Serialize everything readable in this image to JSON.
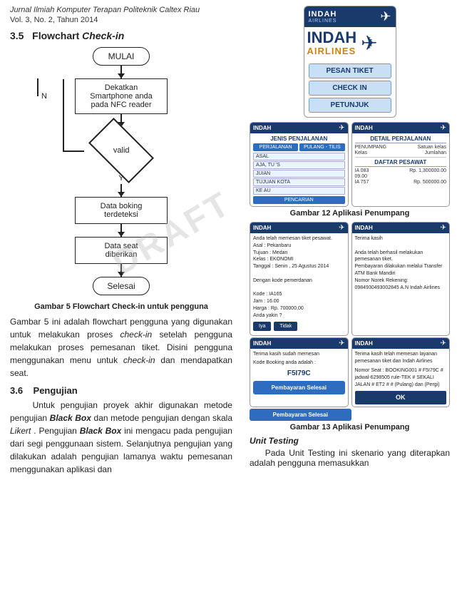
{
  "journal": {
    "title": "Jurnal Ilmiah Komputer Terapan Politeknik Caltex Riau",
    "vol": "Vol. 3, No. 2, Tahun 2014"
  },
  "section35": {
    "number": "3.5",
    "title": "Flowchart",
    "subtitle": "Check-in"
  },
  "flowchart": {
    "start": "MULAI",
    "step1": "Dekatkan\nSmartphone anda\npada NFC reader",
    "decision": "valid",
    "step2": "Data boking\nterdeteksi",
    "step3": "Data seat\ndiberikan",
    "end": "Selesai",
    "n_label": "N",
    "y_label": "Y"
  },
  "figure5": {
    "caption": "Gambar 5 Flowchart Check-in untuk pengguna",
    "desc1": "Gambar 5 ini adalah flowchart pengguna yang digunakan untuk melakukan proses",
    "checkin_italic": "check-in",
    "desc2": "setelah pengguna melakukan proses pemesanan tiket. Disini pengguna menggunakan menu untuk",
    "checkin_italic2": "check-in",
    "desc3": "dan mendapatkan seat."
  },
  "section36": {
    "number": "3.6",
    "title": "Pengujian",
    "desc1": "Untuk pengujian proyek akhir digunakan metode pengujian",
    "blackbox": "Black Box",
    "desc2": "dan metode pengujian dengan skala",
    "likert": "Likert",
    "desc3": ". Pengujian",
    "blackbox2": "Black Box",
    "desc4": "ini mengacu pada pengujian dari segi penggunaan sistem. Selanjutnya pengujian yang dilakukan adalah pengujian lamanya waktu pemesanan menggunakan aplikasi dan"
  },
  "airline": {
    "name": "INDAH",
    "sub": "AIRLINES"
  },
  "mainMenu": {
    "pesan_tiket": "PESAN TIKET",
    "check_in": "CHECK IN",
    "petunjuk": "PETUNJUK"
  },
  "screen_left_title": "JENIS PENJALANAN",
  "screen_left_btns": [
    "PERJALANAN",
    "PULANG - TILIS"
  ],
  "screen_left_fields": [
    "ASAL",
    "AJA, TU 'S",
    "JUIAN",
    "TUJUAN KOTA",
    "KE AU"
  ],
  "screen_right_title": "DETAIL PERJALANAN",
  "screen_right_labels": [
    "PENUMPANG",
    "Satuan kelas",
    "Kelas",
    "Jumlahan"
  ],
  "daftar_title": "DAFTAR PESAWAT",
  "daftar_rows": [
    {
      "code": "IA 083",
      "price": "Rp. 1,300000.00"
    },
    {
      "code": "09.00",
      "price": ""
    },
    {
      "code": "IA 757",
      "price": "Rp. 500000.00"
    }
  ],
  "figure12": "Gambar 12 Aplikasi Penumpang",
  "confirm_left": {
    "title": "INDAH",
    "text": "Anda telah memesan tiket pesawat.\nAsal : Pekanbaru\nTujuan : Medan\nKelas : EKONOMI\nTanggal : Senin , 25 Agustus 2014\n\nDengan kode pemerdanan\n\nKode : IA165\nJam : 16.00\nHarga : Rp. 700000,00\nAnda yakin ?",
    "ya": "Iya",
    "tidak": "Tidak",
    "btn": "Pembayaran Selesai"
  },
  "confirm_right": {
    "title": "INDAH",
    "text": "Terima kasih\n\nAnda telah berhasil melakukan pemesanan tiket.\nPembayaran dilakukan melalui Transfer ATM Bank Mandiri\nNomor Norek Rekening:\n0984930493002845 A.N Indah Airlines"
  },
  "confirm2_left": {
    "title": "INDAH",
    "label": "Terima kasih sudah memesan",
    "kode_label": "Kode Booking anda adalah :",
    "kode_value": "F5I79C",
    "btn": "Pembayaran Selesai"
  },
  "confirm2_right": {
    "title": "INDAH",
    "text": "Terima kasih telah memesan layanan pemesanan tiket dan Indah Airlines",
    "nomor_label": "Nomor Seat : BOOKING001 # F5I79C # jadwal-6298505 rule-TEK # SEKALI JALAN # ET2 # # (Pulang) dan (Pergi)",
    "btn": "OK"
  },
  "figure13": "Gambar 13 Aplikasi Penumpang",
  "unit_testing": {
    "title": "Unit Testing",
    "desc": "Pada Unit Testing ini skenario yang diterapkan adalah pengguna memasukkan"
  }
}
